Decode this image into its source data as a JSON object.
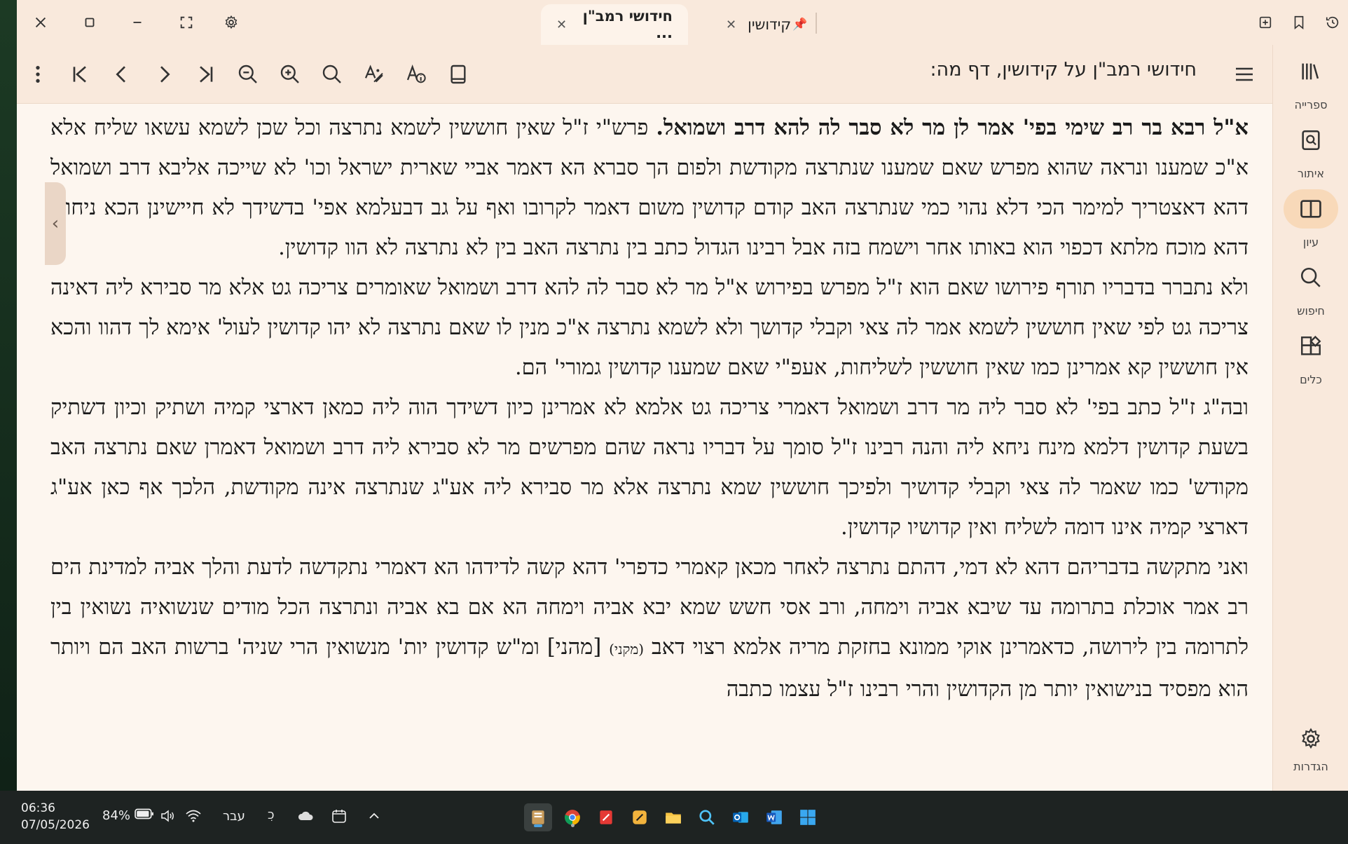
{
  "tabs": [
    {
      "label": "חידושי רמב\"ן ...",
      "active": true
    },
    {
      "label": "קידושין",
      "pinned": true,
      "active": false
    }
  ],
  "toolbar": {
    "book_title": "חידושי רמב\"ן על קידושין, דף מה:"
  },
  "sidebar": {
    "items": [
      {
        "label": "ספרייה",
        "icon": "library-icon"
      },
      {
        "label": "איתור",
        "icon": "locate-icon"
      },
      {
        "label": "עיון",
        "icon": "book-open-icon",
        "active": true
      },
      {
        "label": "חיפוש",
        "icon": "search-icon"
      },
      {
        "label": "כלים",
        "icon": "tools-icon"
      },
      {
        "label": "הגדרות",
        "icon": "settings-icon"
      }
    ]
  },
  "content": {
    "paragraphs": [
      {
        "bold": "א\"ל רבא בר רב שימי בפי' אמר לן מר לא סבר לה להא דרב ושמואל.",
        "text": " פרש\"י ז\"ל שאין חוששין לשמא נתרצה וכל שכן לשמא עשאו שליח אלא א\"כ שמענו ונראה שהוא מפרש שאם שמענו שנתרצה מקודשת ולפום הך סברא הא דאמר אביי שארית ישראל וכו' לא שייכה אליבא דרב ושמואל דהא דאצטריך למימר הכי דלא נהוי כמי שנתרצה האב קודם קדושין משום דאמר לקרובו ואף על גב דבעלמא אפי' בדשידך לא חיישינן הכא ניחוש דהא מוכח מלתא דכפוי הוא באותו אחר וישמח בזה אבל רבינו הגדול כתב בין נתרצה האב בין לא נתרצה לא הוו קדושין."
      },
      {
        "text": "ולא נתברר בדבריו תורף פירושו שאם הוא ז\"ל מפרש בפירוש א\"ל מר לא סבר לה להא דרב ושמואל שאומרים צריכה גט אלא מר סבירא ליה דאינה צריכה גט לפי שאין חוששין לשמא אמר לה צאי וקבלי קדושך ולא לשמא נתרצה א\"כ מנין לו שאם נתרצה לא יהו קדושין לעול' אימא לך דהוו והכא אין חוששין קא אמרינן כמו שאין חוששין לשליחות, אעפ\"י שאם שמענו קדושין גמורי' הם."
      },
      {
        "text": "ובה\"ג ז\"ל כתב בפי' לא סבר ליה מר דרב ושמואל דאמרי צריכה גט אלמא לא אמרינן כיון דשידך הוה ליה כמאן דארצי קמיה ושתיק וכיון דשתיק בשעת קדושין דלמא מינח ניחא ליה והנה רבינו ז\"ל סומך על דבריו נראה שהם מפרשים מר לא סבירא ליה דרב ושמואל דאמרן שאם נתרצה האב מקודש' כמו שאמר לה צאי וקבלי קדושיך ולפיכך חוששין שמא נתרצה אלא מר סבירא ליה אע\"ג שנתרצה אינה מקודשת, הלכך אף כאן אע\"ג דארצי קמיה אינו דומה לשליח ואין קדושיו קדושין."
      },
      {
        "text_a": "ואני מתקשה בדבריהם דהא לא דמי, דהתם נתרצה לאחר מכאן קאמרי כדפרי' דהא קשה לדידהו הא דאמרי נתקדשה לדעת והלך אביה למדינת הים רב אמר אוכלת בתרומה עד שיבא אביה וימחה, ורב אסי חשש שמא יבא אביה וימחה הא אם בא אביה ונתרצה הכל מודים שנשואיה נשואין בין לתרומה בין לירושה, כדאמרינן אוקי ממונא בחזקת מריה אלמא רצוי דאב ",
        "small": "(מקני)",
        "text_b": " [מהני] ומ\"ש קדושין יות' מנשואין הרי שניה' ברשות האב הם ויותר הוא מפסיד בנישואין יותר מן הקדושין והרי רבינו ז\"ל עצמו כתבה"
      }
    ]
  },
  "taskbar": {
    "time": "06:36",
    "date": "07/05/2026",
    "battery": "84%",
    "language": "עבר"
  },
  "colors": {
    "window_bg": "#fdf6ef",
    "chrome_bg": "#f9e9dc",
    "active_side": "#f8d9b9",
    "taskbar_bg": "#1e2322"
  }
}
